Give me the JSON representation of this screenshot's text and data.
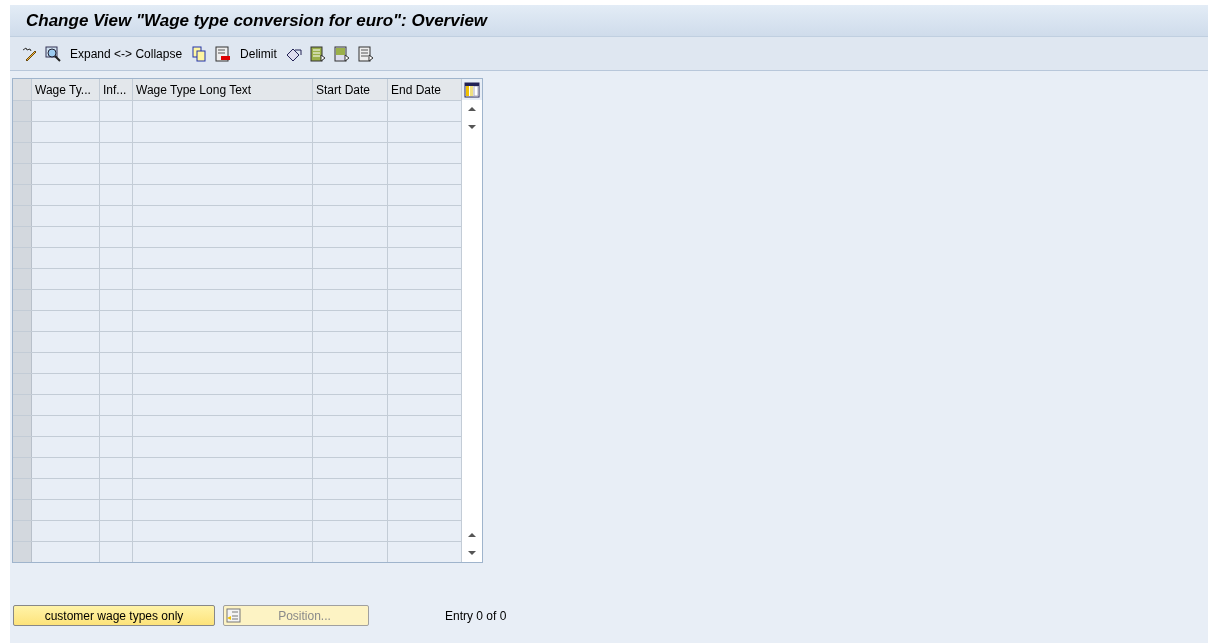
{
  "window": {
    "title": "Change View \"Wage type conversion for euro\": Overview"
  },
  "toolbar": {
    "buttons": [
      "Expand <-> Collapse",
      "Delimit"
    ]
  },
  "table": {
    "columns": [
      "Wage Ty...",
      "Inf...",
      "Wage Type Long Text",
      "Start Date",
      "End Date"
    ]
  },
  "footer": {
    "buttons": [
      {
        "label": "customer wage types only",
        "disabled": false
      },
      {
        "label": "Position...",
        "disabled": true
      }
    ],
    "entry_count": "Entry 0 of 0"
  }
}
